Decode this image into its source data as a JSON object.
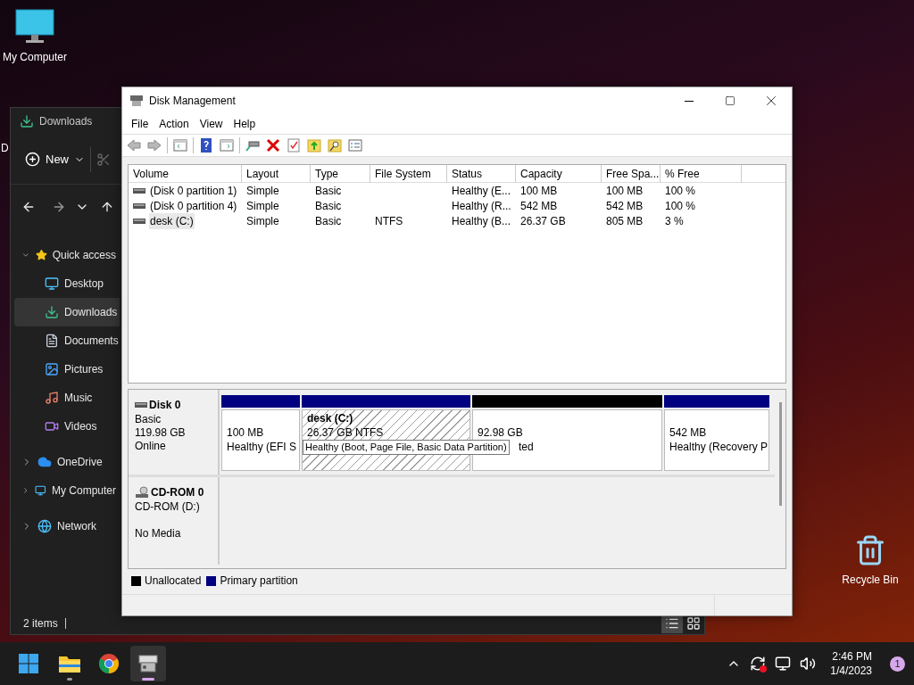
{
  "desktop_icons": [
    {
      "kind": "computer",
      "label": "My Computer"
    },
    {
      "kind": "hidden",
      "label": "D"
    },
    {
      "kind": "recycle",
      "label": "Recycle Bin"
    }
  ],
  "explorer": {
    "title": "Downloads",
    "new_button": "New",
    "tree": [
      {
        "label": "Quick access",
        "expanded": true,
        "selected": false,
        "children": [
          {
            "label": "Desktop",
            "selected": false
          },
          {
            "label": "Downloads",
            "selected": true
          },
          {
            "label": "Documents",
            "selected": false
          },
          {
            "label": "Pictures",
            "selected": false
          },
          {
            "label": "Music",
            "selected": false
          },
          {
            "label": "Videos",
            "selected": false
          }
        ]
      },
      {
        "label": "OneDrive",
        "expanded": false,
        "selected": false
      },
      {
        "label": "My Computer",
        "expanded": false,
        "selected": false
      },
      {
        "label": "Network",
        "expanded": false,
        "selected": false
      }
    ],
    "status": "2 items",
    "view_buttons": [
      {
        "kind": "details",
        "selected": true
      },
      {
        "kind": "tiles",
        "selected": false
      }
    ]
  },
  "disk_management": {
    "title": "Disk Management",
    "menu": [
      "File",
      "Action",
      "View",
      "Help"
    ],
    "columns": [
      "Volume",
      "Layout",
      "Type",
      "File System",
      "Status",
      "Capacity",
      "Free Spa...",
      "% Free"
    ],
    "rows": [
      {
        "selected": false,
        "cells": [
          "(Disk 0 partition 1)",
          "Simple",
          "Basic",
          "",
          "Healthy (E...",
          "100 MB",
          "100 MB",
          "100 %"
        ]
      },
      {
        "selected": false,
        "cells": [
          "(Disk 0 partition 4)",
          "Simple",
          "Basic",
          "",
          "Healthy (R...",
          "542 MB",
          "542 MB",
          "100 %"
        ]
      },
      {
        "selected": true,
        "cells": [
          "desk (C:)",
          "Simple",
          "Basic",
          "NTFS",
          "Healthy (B...",
          "26.37 GB",
          "805 MB",
          "3 %"
        ]
      }
    ],
    "disks": [
      {
        "kind": "disk",
        "name": "Disk 0",
        "info": [
          "Basic",
          "119.98 GB",
          "Online"
        ],
        "partitions": [
          {
            "color": "#000080",
            "selected": false,
            "covered": false,
            "lines": [
              "100 MB",
              "Healthy (EFI S"
            ]
          },
          {
            "color": "#000080",
            "selected": true,
            "covered": false,
            "name": "desk  (C:)",
            "lines": [
              "26.37 GB NTFS"
            ]
          },
          {
            "color": "#000000",
            "selected": false,
            "covered": true,
            "lines": [
              "92.98 GB",
              "ted"
            ]
          },
          {
            "color": "#000080",
            "selected": false,
            "covered": false,
            "lines": [
              "542 MB",
              "Healthy (Recovery P"
            ]
          }
        ],
        "tooltip": "Healthy (Boot, Page File, Basic Data Partition)"
      },
      {
        "kind": "cdrom",
        "name": "CD-ROM 0",
        "info": [
          "CD-ROM (D:)",
          "No Media"
        ]
      }
    ],
    "legend": [
      {
        "label": "Unallocated",
        "color": "#000000"
      },
      {
        "label": "Primary partition",
        "color": "#000080"
      }
    ]
  },
  "taskbar": {
    "apps": [
      {
        "kind": "explorer",
        "running": true,
        "selected": false
      },
      {
        "kind": "chrome",
        "running": false,
        "selected": false
      },
      {
        "kind": "diskmgmt",
        "running": true,
        "selected": true
      }
    ],
    "time": "2:46 PM",
    "date": "1/4/2023",
    "notifications": "1"
  }
}
